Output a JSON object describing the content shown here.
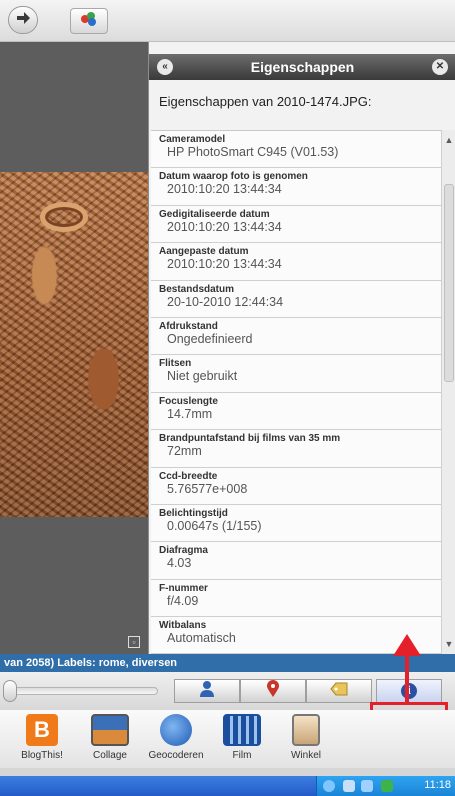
{
  "panel": {
    "title": "Eigenschappen",
    "subtitle": "Eigenschappen van 2010-1474.JPG:",
    "properties": [
      {
        "label": "Cameramodel",
        "value": "HP PhotoSmart C945 (V01.53)"
      },
      {
        "label": "Datum waarop foto is genomen",
        "value": "2010:10:20 13:44:34"
      },
      {
        "label": "Gedigitaliseerde datum",
        "value": "2010:10:20 13:44:34"
      },
      {
        "label": "Aangepaste datum",
        "value": "2010:10:20 13:44:34"
      },
      {
        "label": "Bestandsdatum",
        "value": "20-10-2010 12:44:34"
      },
      {
        "label": "Afdrukstand",
        "value": "Ongedefinieerd"
      },
      {
        "label": "Flitsen",
        "value": "Niet gebruikt"
      },
      {
        "label": "Focuslengte",
        "value": "14.7mm"
      },
      {
        "label": "Brandpuntafstand bij films van 35 mm",
        "value": "72mm"
      },
      {
        "label": "Ccd-breedte",
        "value": "5.76577e+008"
      },
      {
        "label": "Belichtingstijd",
        "value": "0.00647s (1/155)"
      },
      {
        "label": "Diafragma",
        "value": "4.03"
      },
      {
        "label": "F-nummer",
        "value": "f/4.09"
      },
      {
        "label": "Witbalans",
        "value": "Automatisch"
      }
    ]
  },
  "status": {
    "text": "van 2058)   Labels: rome, diversen"
  },
  "tray": {
    "items": [
      {
        "label": "BlogThis!"
      },
      {
        "label": "Collage"
      },
      {
        "label": "Geocoderen"
      },
      {
        "label": "Film"
      },
      {
        "label": "Winkel"
      }
    ]
  },
  "taskbar": {
    "clock": "11:18"
  },
  "colors": {
    "accent": "#e4212b",
    "panel_header": "#4a4a4a",
    "status_bar": "#2f6ea8",
    "taskbar": "#2e6bd6"
  },
  "icons": {
    "forward": "arrow-right-icon",
    "edit": "picasa-edit-icon",
    "people": "person-icon",
    "places": "map-pin-icon",
    "tags": "tag-icon",
    "info": "info-icon"
  }
}
